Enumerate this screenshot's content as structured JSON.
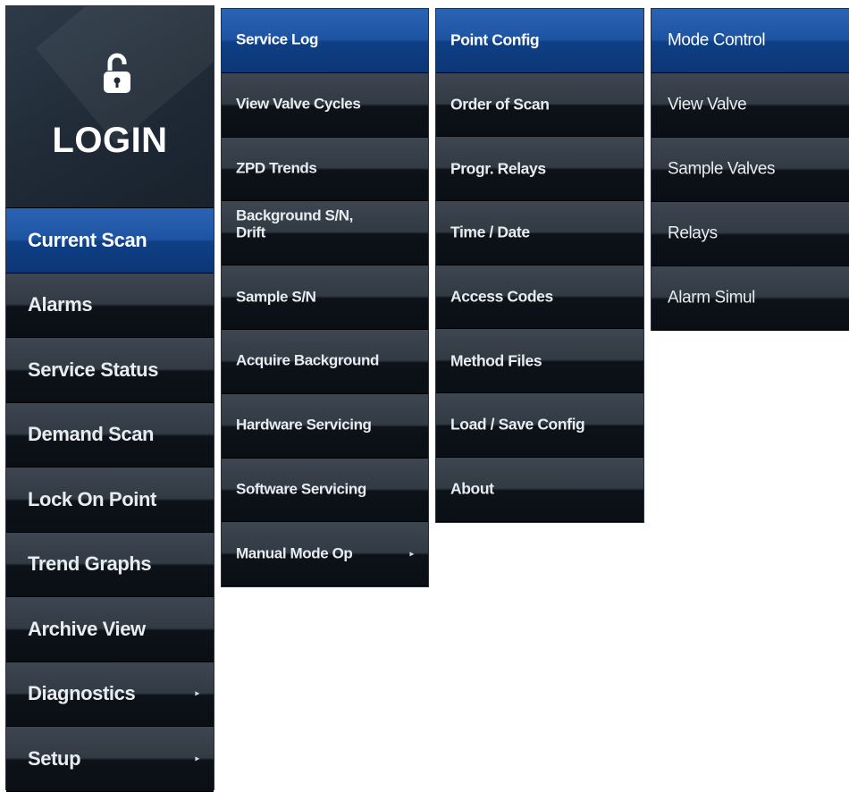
{
  "main_menu": {
    "login_label": "LOGIN",
    "items": [
      {
        "label": "Current Scan",
        "has_submenu": false,
        "active": true
      },
      {
        "label": "Alarms",
        "has_submenu": false
      },
      {
        "label": "Service Status",
        "has_submenu": false
      },
      {
        "label": "Demand Scan",
        "has_submenu": false
      },
      {
        "label": "Lock On Point",
        "has_submenu": false
      },
      {
        "label": "Trend Graphs",
        "has_submenu": false
      },
      {
        "label": "Archive View",
        "has_submenu": false
      },
      {
        "label": "Diagnostics",
        "has_submenu": true
      },
      {
        "label": "Setup",
        "has_submenu": true
      }
    ]
  },
  "diagnostics_menu": {
    "items": [
      {
        "label": "Service Log",
        "active": true
      },
      {
        "label": "View Valve Cycles"
      },
      {
        "label": "ZPD Trends"
      },
      {
        "label": "Background S/N,\nDrift"
      },
      {
        "label": "Sample S/N"
      },
      {
        "label": "Acquire Background"
      },
      {
        "label": "Hardware Servicing"
      },
      {
        "label": "Software Servicing"
      },
      {
        "label": "Manual Mode Op",
        "has_submenu": true
      }
    ]
  },
  "setup_menu": {
    "items": [
      {
        "label": "Point Config",
        "active": true
      },
      {
        "label": "Order of Scan"
      },
      {
        "label": "Progr. Relays"
      },
      {
        "label": "Time / Date"
      },
      {
        "label": "Access Codes"
      },
      {
        "label": "Method Files"
      },
      {
        "label": "Load / Save Config"
      },
      {
        "label": "About"
      }
    ]
  },
  "manual_mode_menu": {
    "items": [
      {
        "label": "Mode Control",
        "active": true
      },
      {
        "label": "View Valve"
      },
      {
        "label": "Sample Valves"
      },
      {
        "label": "Relays"
      },
      {
        "label": "Alarm Simul"
      }
    ]
  },
  "icons": {
    "lock": "unlocked-padlock-icon",
    "submenu_arrow": "arrow-right-icon"
  },
  "colors": {
    "active_item": "#1d54a2",
    "menu_background": "#0a0f17",
    "text": "#e9ecef"
  }
}
